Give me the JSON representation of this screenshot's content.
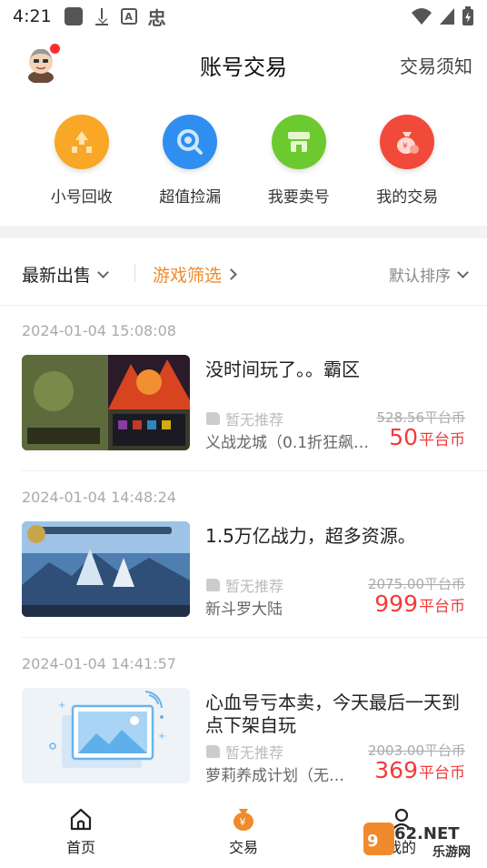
{
  "status_bar": {
    "time": "4:21",
    "icons": [
      "notification-square-icon",
      "download-icon",
      "a-box-icon",
      "app-glyph-icon",
      "wifi-icon",
      "signal-icon",
      "battery-icon"
    ],
    "app_glyph": "忠"
  },
  "header": {
    "title": "账号交易",
    "notice_label": "交易须知"
  },
  "quick_actions": [
    {
      "label": "小号回收",
      "icon": "recycle-icon",
      "color": "#f9a726"
    },
    {
      "label": "超值捡漏",
      "icon": "magnifier-coin-icon",
      "color": "#2e8ff0"
    },
    {
      "label": "我要卖号",
      "icon": "shop-icon",
      "color": "#6cc92f"
    },
    {
      "label": "我的交易",
      "icon": "money-bag-icon",
      "color": "#f24a3a"
    }
  ],
  "filters": {
    "latest": "最新出售",
    "game_filter": "游戏筛选",
    "sort": "默认排序"
  },
  "listings": [
    {
      "date": "2024-01-04 15:08:08",
      "title": "没时间玩了。。霸区",
      "recommend": "暂无推荐",
      "game": "义战龙城（0.1折狂飙…",
      "original_price": "528.56平台币",
      "price": "50",
      "unit": "平台币"
    },
    {
      "date": "2024-01-04 14:48:24",
      "title": "1.5万亿战力，超多资源。",
      "recommend": "暂无推荐",
      "game": "新斗罗大陆",
      "original_price": "2075.00平台币",
      "price": "999",
      "unit": "平台币"
    },
    {
      "date": "2024-01-04 14:41:57",
      "title": "心血号亏本卖，今天最后一天到点下架自玩",
      "recommend": "暂无推荐",
      "game": "萝莉养成计划（无…",
      "original_price": "2003.00平台币",
      "price": "369",
      "unit": "平台币"
    }
  ],
  "bottom_nav": [
    {
      "label": "首页",
      "icon": "home-icon"
    },
    {
      "label": "交易",
      "icon": "money-bag-icon",
      "active": true
    },
    {
      "label": "我的",
      "icon": "profile-icon"
    }
  ],
  "watermark": {
    "brand": "962.NET",
    "sub": "乐游网"
  },
  "colors": {
    "accent_orange": "#f08a2c",
    "price_red": "#f23b3b"
  }
}
